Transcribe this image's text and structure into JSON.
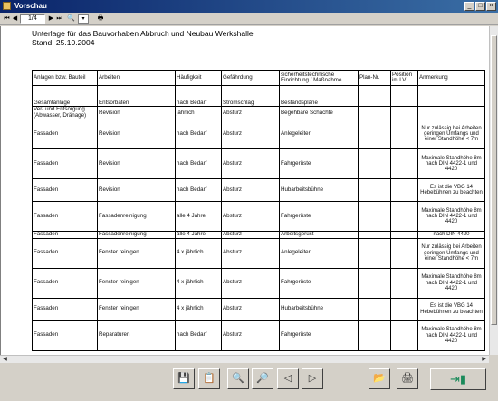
{
  "window": {
    "title": "Vorschau"
  },
  "toolbar": {
    "page": "1/4"
  },
  "document": {
    "title": "Unterlage für das Bauvorhaben Abbruch und Neubau Werkshalle",
    "date": "Stand: 25.10.2004"
  },
  "table": {
    "headers": [
      "Anlagen bzw. Bauteil",
      "Arbeiten",
      "Häufigkeit",
      "Gefährdung",
      "sicherheitstechnische Einrichtung / Maßnahme",
      "Plan-Nr.",
      "Position im LV",
      "Anmerkung"
    ],
    "rows": [
      [
        "Gesamtanlage",
        "Entsorbaten",
        "nach Bedarf",
        "Stromschlag",
        "Bestandspläne",
        "",
        "",
        ""
      ],
      [
        "Ver- und Entsorgung (Abwasser, Dränage)",
        "Revision",
        "jährlich",
        "Absturz",
        "Begehbare Schächte",
        "",
        "",
        ""
      ],
      [
        "Fassaden",
        "Revision",
        "nach Bedarf",
        "Absturz",
        "Anlegeleiter",
        "",
        "",
        "Nur zulässig bei Arbeiten geringen Umfangs und einer Standhöhe < 7m"
      ],
      [
        "Fassaden",
        "Revision",
        "nach Bedarf",
        "Absturz",
        "Fahrgerüste",
        "",
        "",
        "Maximale Standhöhe 8m nach DIN 4422-1 und 4420"
      ],
      [
        "Fassaden",
        "Revision",
        "nach Bedarf",
        "Absturz",
        "Hubarbeitsbühne",
        "",
        "",
        "Es ist die VBG 14 Hebebühnen zu beachten"
      ],
      [
        "Fassaden",
        "Fassadenreinigung",
        "alle 4 Jahre",
        "Absturz",
        "Fahrgerüste",
        "",
        "",
        "Maximale Standhöhe 8m nach DIN 4422-1 und 4420"
      ],
      [
        "Fassaden",
        "Fassadenreinigung",
        "alle 4 Jahre",
        "Absturz",
        "Arbeitsgerüst",
        "",
        "",
        "nach DIN 4420"
      ],
      [
        "Fassaden",
        "Fenster reinigen",
        "4 x jährlich",
        "Absturz",
        "Anlegeleiter",
        "",
        "",
        "Nur zulässig bei Arbeiten geringen Umfangs und einer Standhöhe < 7m"
      ],
      [
        "Fassaden",
        "Fenster reinigen",
        "4 x jährlich",
        "Absturz",
        "Fahrgerüste",
        "",
        "",
        "Maximale Standhöhe 8m nach DIN 4422-1 und 4420"
      ],
      [
        "Fassaden",
        "Fenster reinigen",
        "4 x jährlich",
        "Absturz",
        "Hubarbeitsbühne",
        "",
        "",
        "Es ist die VBG 14 Hebebühnen zu beachten"
      ],
      [
        "Fassaden",
        "Reparaturen",
        "nach Bedarf",
        "Absturz",
        "Fahrgerüste",
        "",
        "",
        "Maximale Standhöhe 8m nach DIN 4422-1 und 4420"
      ]
    ]
  }
}
